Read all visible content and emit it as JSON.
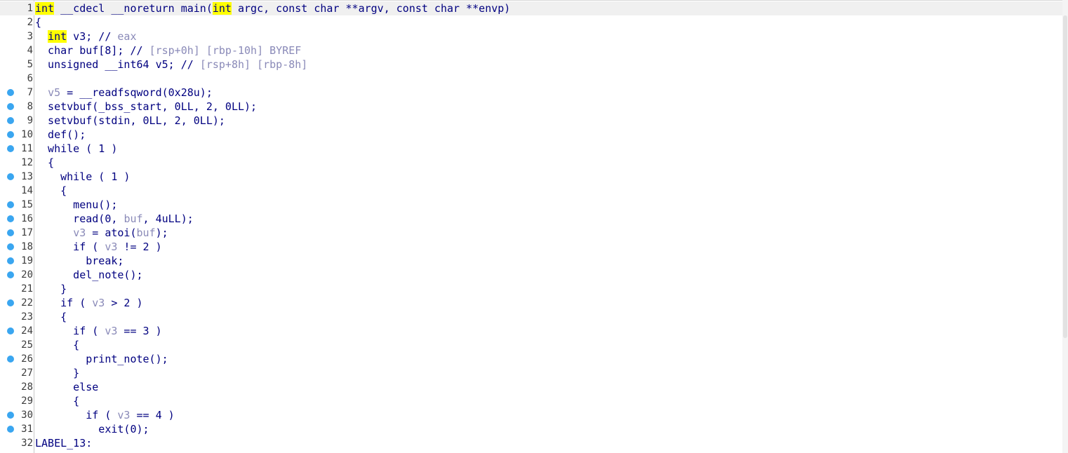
{
  "viewer": {
    "lines": [
      {
        "num": "1",
        "bp": false,
        "current": true,
        "parts": [
          {
            "t": "int",
            "hl": true
          },
          {
            "t": " __cdecl __noreturn main("
          },
          {
            "t": "int",
            "hl": true
          },
          {
            "t": " argc, const char **argv, const char **envp)"
          }
        ]
      },
      {
        "num": "2",
        "bp": false,
        "parts": [
          {
            "t": "{"
          }
        ]
      },
      {
        "num": "3",
        "bp": false,
        "parts": [
          {
            "t": "  "
          },
          {
            "t": "int",
            "hl": true
          },
          {
            "t": " v3; // "
          },
          {
            "t": "eax",
            "g": true
          }
        ]
      },
      {
        "num": "4",
        "bp": false,
        "parts": [
          {
            "t": "  char buf[8]; // "
          },
          {
            "t": "[rsp+0h] [rbp-10h] BYREF",
            "g": true
          }
        ]
      },
      {
        "num": "5",
        "bp": false,
        "parts": [
          {
            "t": "  unsigned __int64 v5; // "
          },
          {
            "t": "[rsp+8h] [rbp-8h]",
            "g": true
          }
        ]
      },
      {
        "num": "6",
        "bp": false,
        "parts": []
      },
      {
        "num": "7",
        "bp": true,
        "parts": [
          {
            "t": "  "
          },
          {
            "t": "v5",
            "g": true
          },
          {
            "t": " = __readfsqword(0x28u);"
          }
        ]
      },
      {
        "num": "8",
        "bp": true,
        "parts": [
          {
            "t": "  setvbuf(_bss_start, 0LL, 2, 0LL);"
          }
        ]
      },
      {
        "num": "9",
        "bp": true,
        "parts": [
          {
            "t": "  setvbuf(stdin, 0LL, 2, 0LL);"
          }
        ]
      },
      {
        "num": "10",
        "bp": true,
        "parts": [
          {
            "t": "  def();"
          }
        ]
      },
      {
        "num": "11",
        "bp": true,
        "parts": [
          {
            "t": "  while ( 1 )"
          }
        ]
      },
      {
        "num": "12",
        "bp": false,
        "parts": [
          {
            "t": "  {"
          }
        ]
      },
      {
        "num": "13",
        "bp": true,
        "parts": [
          {
            "t": "    while ( 1 )"
          }
        ]
      },
      {
        "num": "14",
        "bp": false,
        "parts": [
          {
            "t": "    {"
          }
        ]
      },
      {
        "num": "15",
        "bp": true,
        "parts": [
          {
            "t": "      menu();"
          }
        ]
      },
      {
        "num": "16",
        "bp": true,
        "parts": [
          {
            "t": "      read(0, "
          },
          {
            "t": "buf",
            "g": true
          },
          {
            "t": ", 4uLL);"
          }
        ]
      },
      {
        "num": "17",
        "bp": true,
        "parts": [
          {
            "t": "      "
          },
          {
            "t": "v3",
            "g": true
          },
          {
            "t": " = atoi("
          },
          {
            "t": "buf",
            "g": true
          },
          {
            "t": ");"
          }
        ]
      },
      {
        "num": "18",
        "bp": true,
        "parts": [
          {
            "t": "      if ( "
          },
          {
            "t": "v3",
            "g": true
          },
          {
            "t": " != 2 )"
          }
        ]
      },
      {
        "num": "19",
        "bp": true,
        "parts": [
          {
            "t": "        break;"
          }
        ]
      },
      {
        "num": "20",
        "bp": true,
        "parts": [
          {
            "t": "      del_note();"
          }
        ]
      },
      {
        "num": "21",
        "bp": false,
        "parts": [
          {
            "t": "    }"
          }
        ]
      },
      {
        "num": "22",
        "bp": true,
        "parts": [
          {
            "t": "    if ( "
          },
          {
            "t": "v3",
            "g": true
          },
          {
            "t": " > 2 )"
          }
        ]
      },
      {
        "num": "23",
        "bp": false,
        "parts": [
          {
            "t": "    {"
          }
        ]
      },
      {
        "num": "24",
        "bp": true,
        "parts": [
          {
            "t": "      if ( "
          },
          {
            "t": "v3",
            "g": true
          },
          {
            "t": " == 3 )"
          }
        ]
      },
      {
        "num": "25",
        "bp": false,
        "parts": [
          {
            "t": "      {"
          }
        ]
      },
      {
        "num": "26",
        "bp": true,
        "parts": [
          {
            "t": "        print_note();"
          }
        ]
      },
      {
        "num": "27",
        "bp": false,
        "parts": [
          {
            "t": "      }"
          }
        ]
      },
      {
        "num": "28",
        "bp": false,
        "parts": [
          {
            "t": "      else"
          }
        ]
      },
      {
        "num": "29",
        "bp": false,
        "parts": [
          {
            "t": "      {"
          }
        ]
      },
      {
        "num": "30",
        "bp": true,
        "parts": [
          {
            "t": "        if ( "
          },
          {
            "t": "v3",
            "g": true
          },
          {
            "t": " == 4 )"
          }
        ]
      },
      {
        "num": "31",
        "bp": true,
        "parts": [
          {
            "t": "          exit(0);"
          }
        ]
      },
      {
        "num": "32",
        "bp": false,
        "parts": [
          {
            "t": "LABEL_13:"
          }
        ]
      }
    ]
  },
  "colors": {
    "code_text": "#000080",
    "comment_gray": "#8a8ab8",
    "highlight": "#ffff00",
    "breakpoint": "#3aa6f0",
    "line_number": "#3c3c3c"
  },
  "icons": {
    "breakpoint": "breakpoint-dot-icon"
  }
}
